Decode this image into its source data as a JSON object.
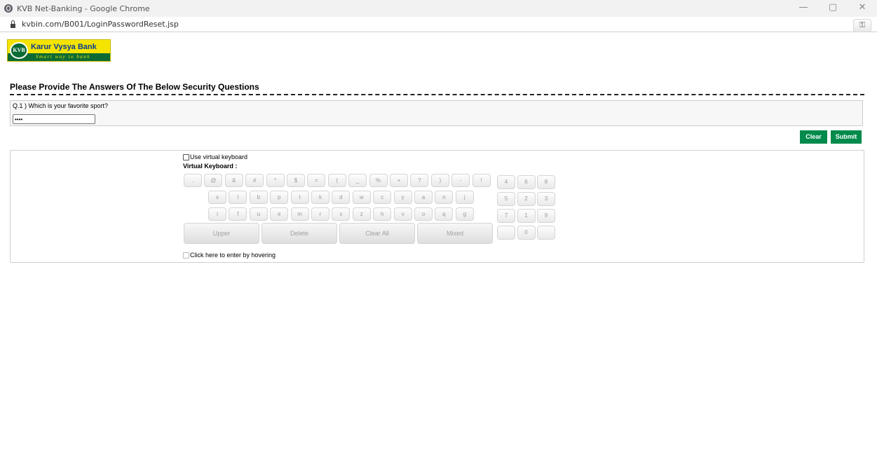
{
  "browser": {
    "window_title": "KVB Net-Banking - Google Chrome",
    "url": "kvbin.com/B001/LoginPasswordReset.jsp",
    "controls": {
      "minimize": "—",
      "restore": "▢",
      "close": "✕"
    },
    "key_icon": "key-icon"
  },
  "logo": {
    "seal": "KVB",
    "name": "Karur Vysya Bank",
    "tagline": "Smart way to bank",
    "colors": {
      "yellow": "#f5e400",
      "green": "#0c6b35",
      "blue": "#0a3d8f"
    }
  },
  "page": {
    "heading": "Please Provide The Answers Of The Below Security Questions",
    "question": "Q.1 ) Which is your favorite sport?",
    "answer_value": "••••",
    "clear_label": "Clear",
    "submit_label": "Submit",
    "accent": "#008a4b"
  },
  "keyboard": {
    "use_virtual_label": "Use virtual keyboard",
    "title": "Virtual Keyboard :",
    "row1": [
      ".",
      "@",
      "&",
      "#",
      "*",
      "$",
      "=",
      "(",
      "_",
      "%",
      "+",
      "?",
      ")",
      "-",
      "!"
    ],
    "row2": [
      "s",
      "l",
      "b",
      "p",
      "t",
      "k",
      "d",
      "w",
      "c",
      "y",
      "a",
      "n",
      "j"
    ],
    "row3": [
      "i",
      "f",
      "u",
      "e",
      "m",
      "r",
      "x",
      "z",
      "h",
      "v",
      "o",
      "q",
      "g"
    ],
    "actions": [
      "Upper",
      "Delete",
      "Clear All",
      "Mixed"
    ],
    "numpad": [
      [
        "4",
        "6",
        "8"
      ],
      [
        "5",
        "2",
        "3"
      ],
      [
        "7",
        "1",
        "9"
      ],
      [
        "",
        "0",
        ""
      ]
    ],
    "hover_label": "Click here to enter by hovering"
  }
}
